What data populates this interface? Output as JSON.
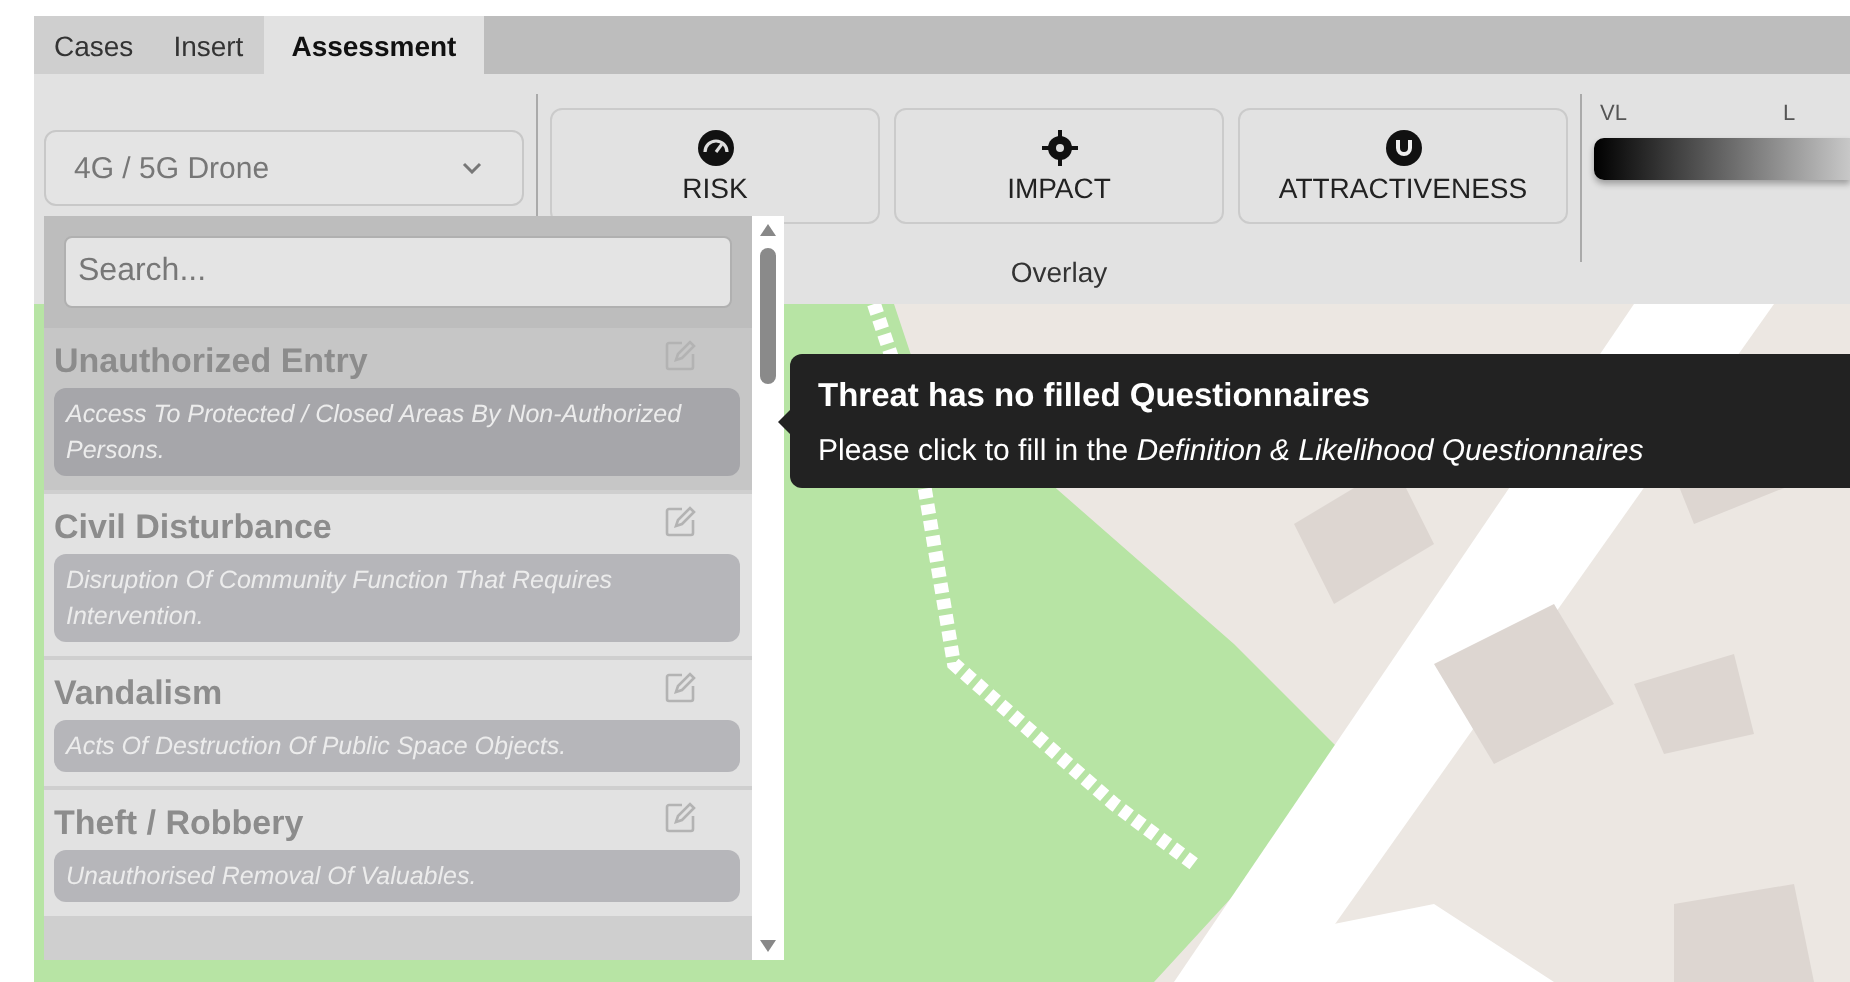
{
  "tabs": [
    {
      "label": "Cases",
      "selected": false
    },
    {
      "label": "Insert",
      "selected": false
    },
    {
      "label": "Assessment",
      "selected": true
    }
  ],
  "ribbon": {
    "threat_dropdown": {
      "value": "4G / 5G Drone"
    },
    "overlay_buttons": [
      {
        "kind": "risk",
        "label": "RISK"
      },
      {
        "kind": "impact",
        "label": "IMPACT"
      },
      {
        "kind": "attractiveness",
        "label": "ATTRACTIVENESS"
      }
    ],
    "overlay_group_label": "Overlay",
    "legend": {
      "labels": [
        "VL",
        "L"
      ]
    }
  },
  "threat_list": {
    "search": {
      "placeholder": "Search..."
    },
    "items": [
      {
        "title": "Unauthorized Entry",
        "description": "Access To Protected / Closed Areas By Non-Authorized Persons.",
        "selected": true
      },
      {
        "title": "Civil Disturbance",
        "description": "Disruption Of Community Function That Requires Intervention.",
        "selected": false
      },
      {
        "title": "Vandalism",
        "description": "Acts Of Destruction Of Public Space Objects.",
        "selected": false
      },
      {
        "title": "Theft / Robbery",
        "description": "Unauthorised Removal Of Valuables.",
        "selected": false
      }
    ]
  },
  "tooltip": {
    "title": "Threat has no filled Questionnaires",
    "body": "Please click to fill in the *Definition & Likelihood Questionnaires*"
  }
}
